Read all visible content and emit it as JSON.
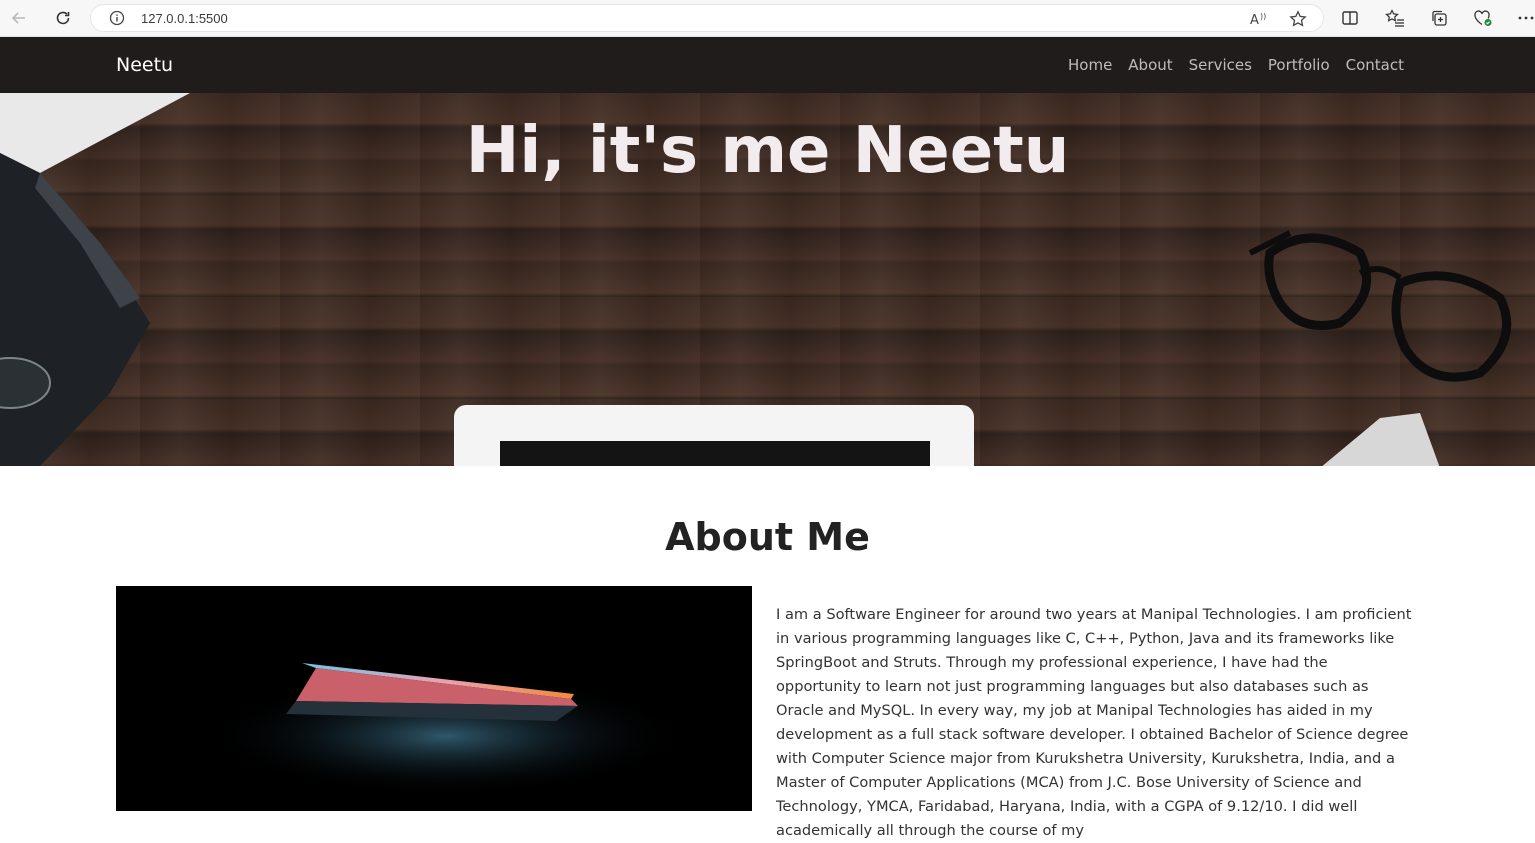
{
  "browser": {
    "url": "127.0.0.1:5500"
  },
  "site": {
    "brand": "Neetu",
    "menu": [
      "Home",
      "About",
      "Services",
      "Portfolio",
      "Contact"
    ]
  },
  "hero": {
    "title": "Hi, it's me Neetu"
  },
  "about": {
    "title": "About Me",
    "text": "I am a Software Engineer for around two years at Manipal Technologies. I am proficient in various programming languages like C, C++, Python, Java and its frameworks like SpringBoot and Struts. Through my professional experience, I have had the opportunity to learn not just programming languages but also databases such as Oracle and MySQL. In every way, my job at Manipal Technologies has aided in my development as a full stack software developer. I obtained Bachelor of Science degree with Computer Science major from Kurukshetra University, Kurukshetra, India, and a Master of Computer Applications (MCA) from J.C. Bose University of Science and Technology, YMCA, Faridabad, Haryana, India, with a CGPA of 9.12/10. I did well academically all through the course of my"
  }
}
